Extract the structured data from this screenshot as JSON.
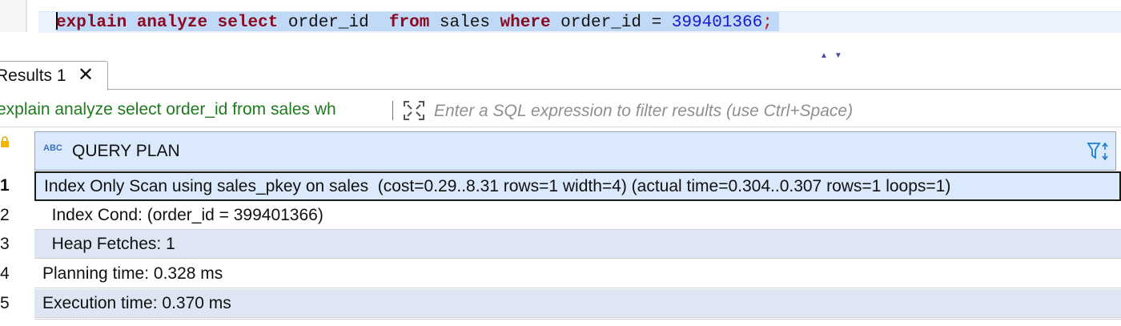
{
  "editor": {
    "tokens": [
      {
        "text": "explain",
        "kind": "kw"
      },
      {
        "text": " ",
        "kind": "id"
      },
      {
        "text": "analyze",
        "kind": "kw"
      },
      {
        "text": " ",
        "kind": "id"
      },
      {
        "text": "select",
        "kind": "kw"
      },
      {
        "text": " order_id  ",
        "kind": "id"
      },
      {
        "text": "from",
        "kind": "kw"
      },
      {
        "text": " sales ",
        "kind": "id"
      },
      {
        "text": "where",
        "kind": "kw"
      },
      {
        "text": " order_id = ",
        "kind": "id"
      },
      {
        "text": "399401366",
        "kind": "num"
      },
      {
        "text": ";",
        "kind": "semi"
      }
    ]
  },
  "results_tab": {
    "label": "Results 1",
    "close": "✕"
  },
  "filter": {
    "query_text": "explain analyze select order_id from sales wh",
    "placeholder": "Enter a SQL expression to filter results (use Ctrl+Space)"
  },
  "grid": {
    "type_badge": "ABC",
    "column_header": "QUERY PLAN",
    "rows": [
      {
        "num": "1",
        "value": "Index Only Scan using sales_pkey on sales  (cost=0.29..8.31 rows=1 width=4) (actual time=0.304..0.307 rows=1 loops=1)"
      },
      {
        "num": "2",
        "value": "  Index Cond: (order_id = 399401366)"
      },
      {
        "num": "3",
        "value": "  Heap Fetches: 1"
      },
      {
        "num": "4",
        "value": "Planning time: 0.328 ms"
      },
      {
        "num": "5",
        "value": "Execution time: 0.370 ms"
      }
    ]
  },
  "colors": {
    "keyword": "#8b0a22",
    "number": "#1a1ad6",
    "selection": "#c0d9f6",
    "header_bg": "#dbe9fc",
    "filter_query": "#1f7a1f"
  },
  "icons": {
    "close": "close-icon",
    "expand": "expand-icon",
    "lock": "lock-icon",
    "abc": "abc-type-icon",
    "filter_sort": "filter-sort-icon",
    "nav": "nav-arrows-icon"
  }
}
